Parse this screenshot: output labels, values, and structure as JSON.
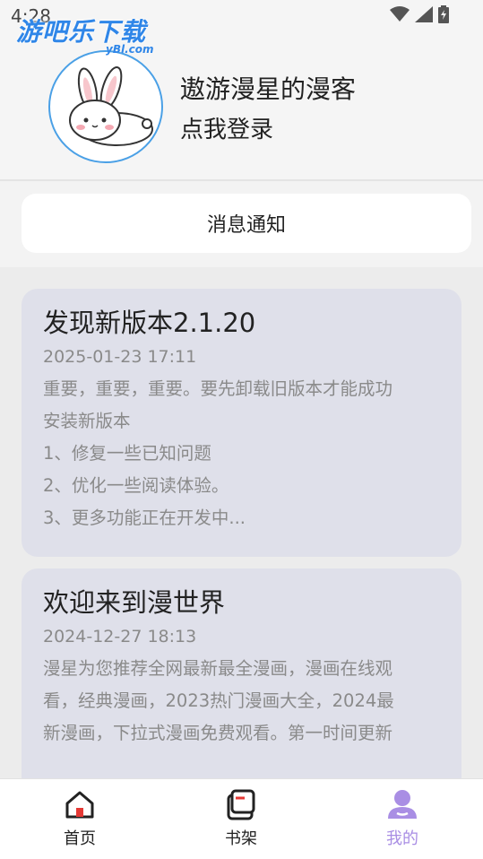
{
  "status_bar": {
    "time": "4:28"
  },
  "watermark": {
    "brand": "游吧乐下载",
    "domain": "yBl.com"
  },
  "profile": {
    "username": "遨游漫星的漫客",
    "login_prompt": "点我登录"
  },
  "notification_button": {
    "label": "消息通知"
  },
  "announcements": [
    {
      "title": "发现新版本2.1.20",
      "date": "2025-01-23 17:11",
      "lines": [
        "重要，重要，重要。要先卸载旧版本才能成功",
        "安装新版本",
        "1、修复一些已知问题",
        "2、优化一些阅读体验。",
        "3、更多功能正在开发中..."
      ]
    },
    {
      "title": "欢迎来到漫世界",
      "date": "2024-12-27 18:13",
      "lines": [
        "漫星为您推荐全网最新最全漫画，漫画在线观",
        "看，经典漫画，2023热门漫画大全，2024最",
        "新漫画，下拉式漫画免费观看。第一时间更新"
      ]
    }
  ],
  "tabbar": {
    "tabs": [
      {
        "label": "首页"
      },
      {
        "label": "书架"
      },
      {
        "label": "我的"
      }
    ]
  },
  "colors": {
    "accent": "#a98ee4",
    "card_bg": "#dfe0ea",
    "avatar_ring": "#4aa0e6"
  }
}
